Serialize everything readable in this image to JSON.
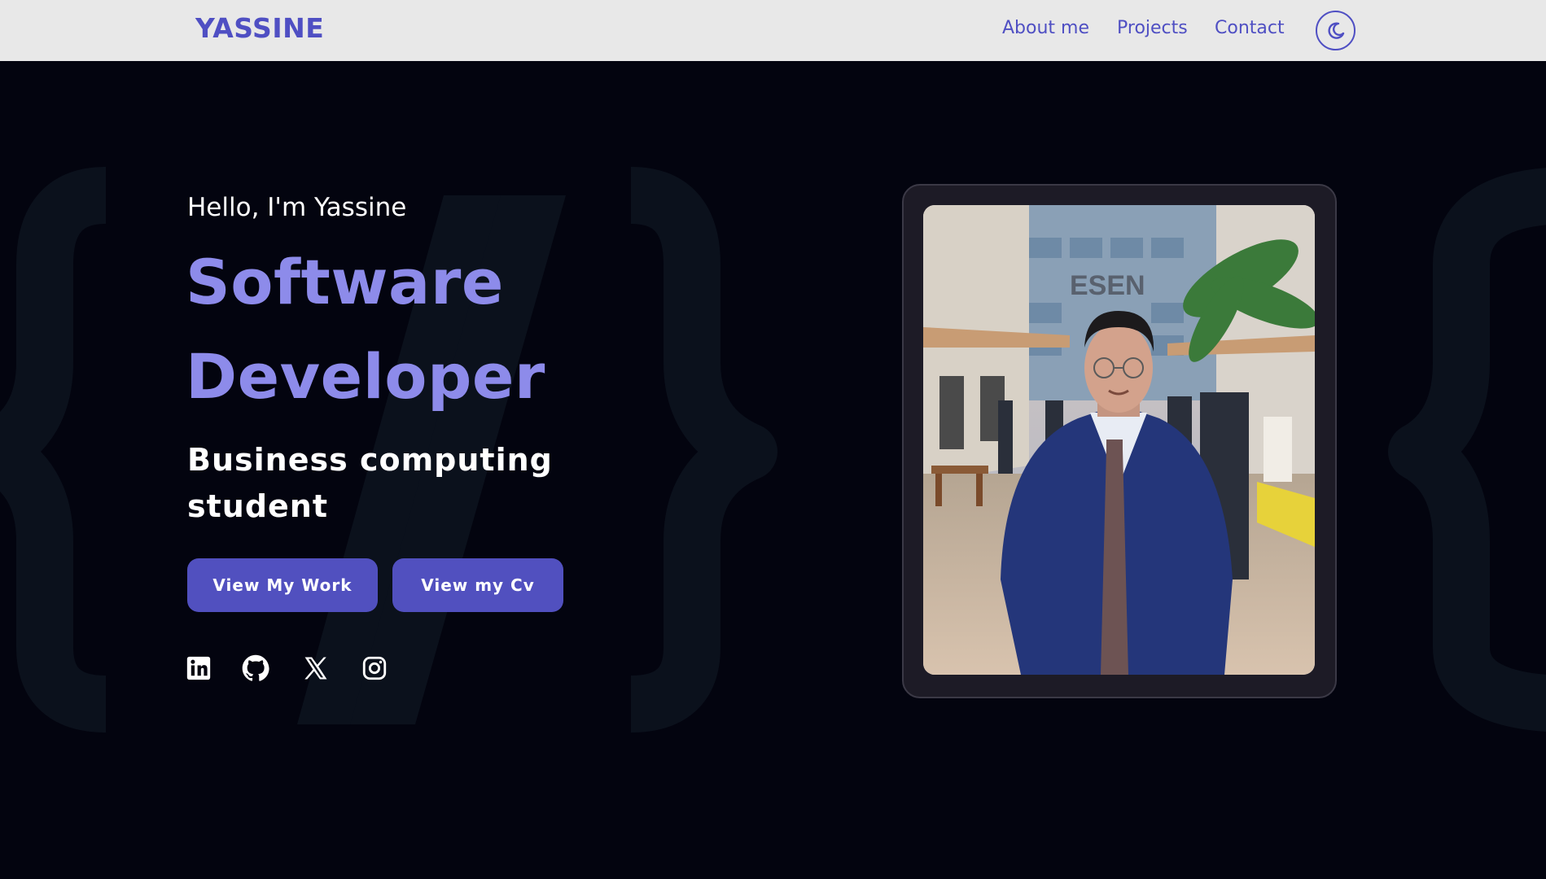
{
  "nav": {
    "logo": "YASSINE",
    "links": [
      {
        "label": "About me"
      },
      {
        "label": "Projects"
      },
      {
        "label": "Contact"
      }
    ],
    "theme_icon": "moon-icon"
  },
  "hero": {
    "greeting": "Hello, I'm Yassine",
    "role_line1": "Software",
    "role_line2": "Developer",
    "subtitle": "Business computing student",
    "buttons": {
      "work": "View My Work",
      "cv": "View my Cv"
    },
    "socials": [
      "linkedin-icon",
      "github-icon",
      "x-icon",
      "instagram-icon"
    ],
    "photo_sign": "ESEN"
  },
  "colors": {
    "accent": "#5150bf",
    "accent_light": "#8d8bea",
    "nav_bg": "#e8e8e8",
    "page_bg": "#03040f"
  }
}
